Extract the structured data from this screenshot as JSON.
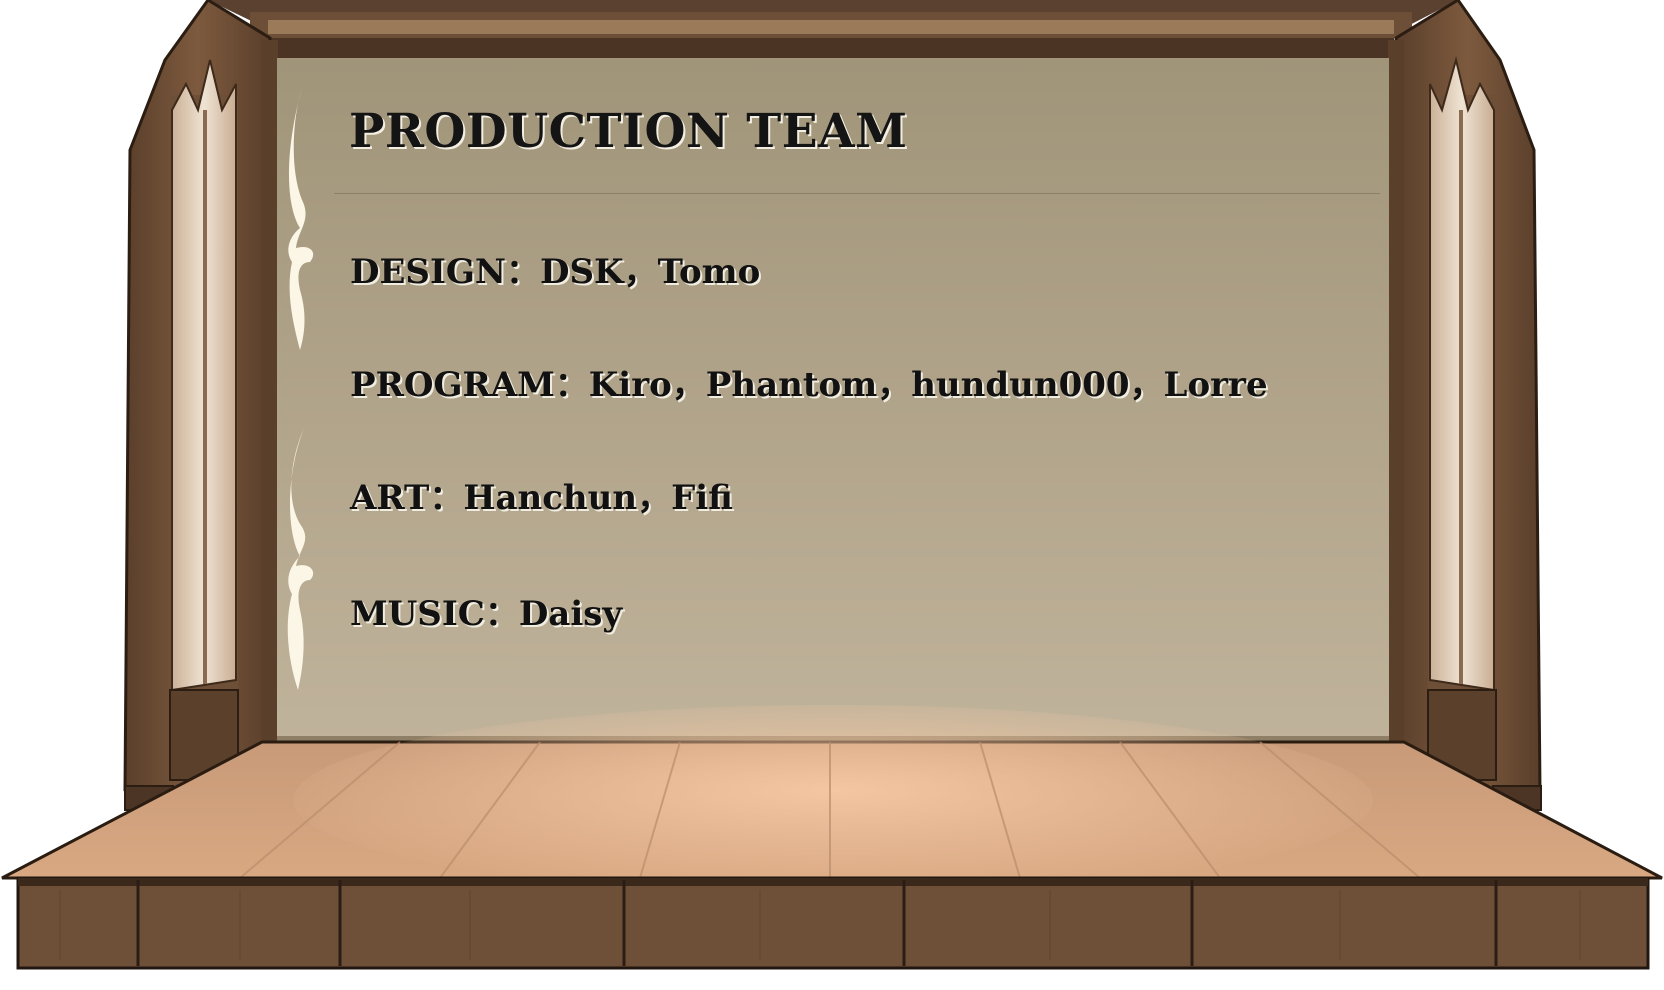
{
  "credits": {
    "title": "PRODUCTION TEAM",
    "rows": [
      {
        "label": "DESIGN",
        "names": "DSK，Tomo"
      },
      {
        "label": "PROGRAM",
        "names": "Kiro，Phantom，hundun000，Lorre"
      },
      {
        "label": "ART",
        "names": "Hanchun，Fifi"
      },
      {
        "label": "MUSIC",
        "names": "Daisy"
      }
    ],
    "separator": "："
  },
  "colors": {
    "backdrop_top": "#a09479",
    "backdrop_bottom": "#c0b39b",
    "wood_dark": "#5e4430",
    "wood_mid": "#7b5a3f",
    "floor_light": "#f0c09b",
    "floor_dark": "#8e6a50",
    "text": "#111111",
    "ornament": "#fbf6e6"
  }
}
